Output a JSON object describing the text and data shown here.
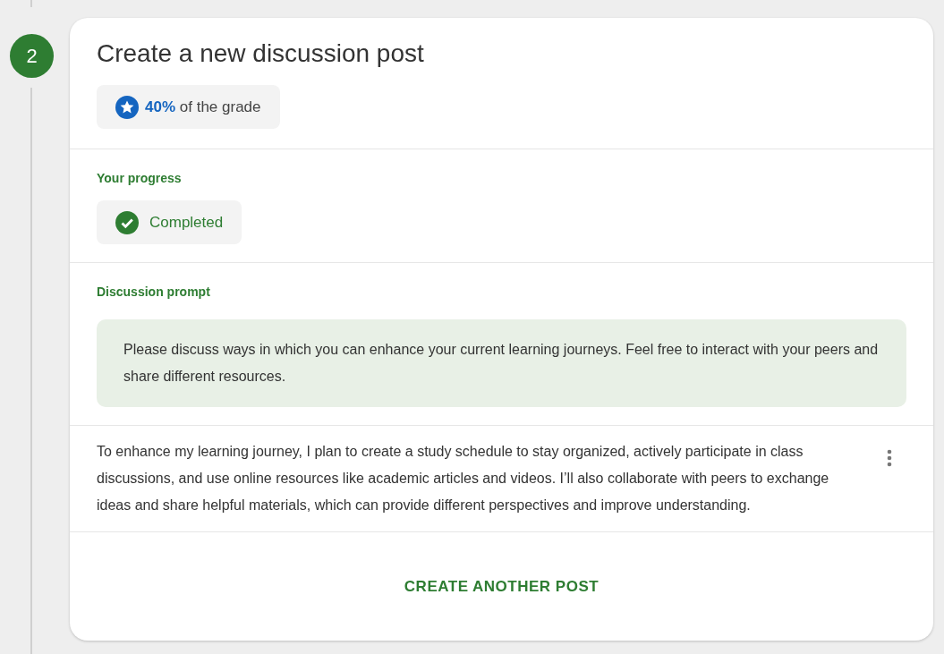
{
  "step": {
    "number": "2",
    "completed": true
  },
  "card": {
    "title": "Create a new discussion post",
    "grade_chip": "**40%** of the grade",
    "progress": {
      "label": "Your progress",
      "status": "Completed",
      "completed": true
    },
    "prompt": {
      "label": "Discussion prompt",
      "text": "Please discuss ways in which you can enhance your current learning journeys. Feel free to interact with your peers and share different resources."
    },
    "post": {
      "text": "To enhance my learning journey, I plan to create a study schedule to stay organized, actively participate in class discussions, and use online resources like academic articles and videos. I’ll also collaborate with peers to exchange ideas and share helpful materials, which can provide different perspectives and improve understanding."
    },
    "action_button": "CREATE ANOTHER POST"
  }
}
